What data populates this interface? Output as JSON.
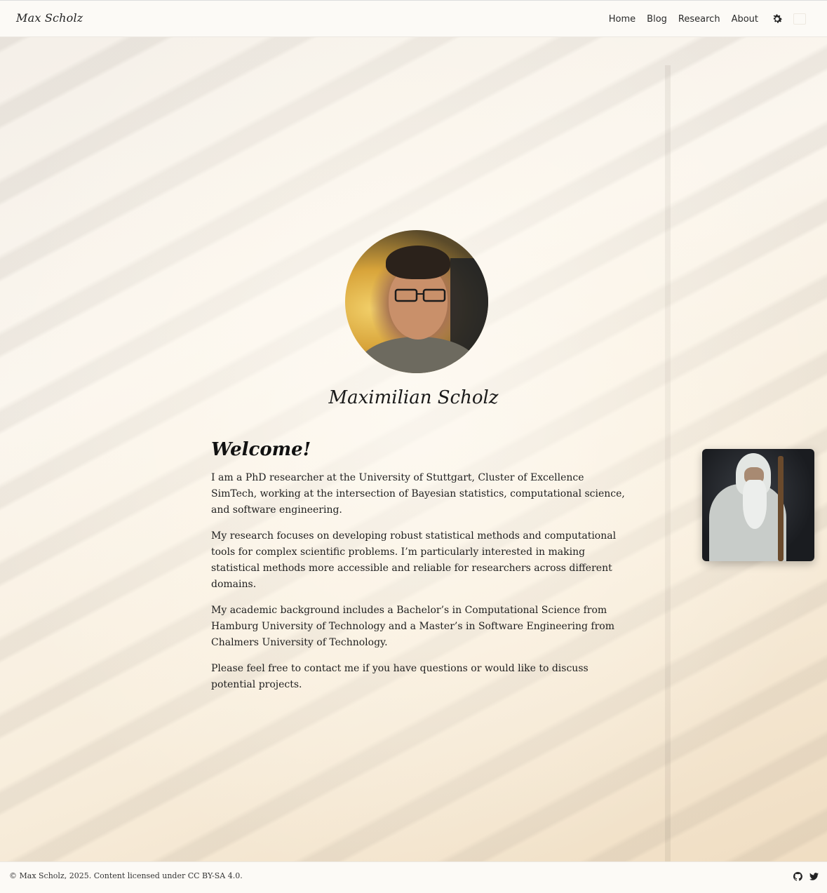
{
  "header": {
    "brand": "Max Scholz",
    "nav": [
      "Home",
      "Blog",
      "Research",
      "About"
    ],
    "theme_icon": "gear-icon"
  },
  "profile": {
    "name": "Maximilian Scholz"
  },
  "main": {
    "heading": "Welcome!",
    "paragraphs": [
      "I am a PhD researcher at the University of Stuttgart, Cluster of Excellence SimTech, working at the intersection of Bayesian statistics, computational science, and software engineering.",
      "My research focuses on developing robust statistical methods and computational tools for complex scientific problems. I’m particularly interested in making statistical methods more accessible and reliable for researchers across different domains.",
      "My academic background includes a Bachelor’s in Computational Science from Hamburg University of Technology and a Master’s in Software Engineering from Chalmers University of Technology.",
      "Please feel free to contact me if you have questions or would like to discuss potential projects."
    ]
  },
  "footer": {
    "copyright": "© Max Scholz, 2025. Content licensed under CC BY-SA 4.0.",
    "icons": [
      "github-icon",
      "twitter-icon"
    ]
  },
  "colors": {
    "header_bg": "#fcfaf6",
    "text": "#1e1e1e"
  }
}
